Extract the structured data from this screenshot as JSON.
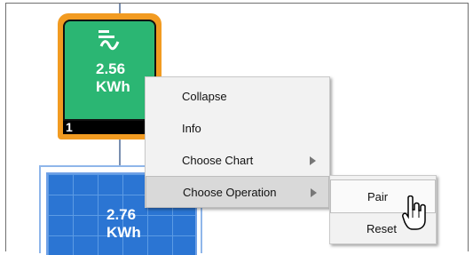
{
  "battery": {
    "energy": "2.56",
    "unit": "KWh",
    "index": "1",
    "fill_color": "#2bb673",
    "border_color": "#f29b21"
  },
  "solar": {
    "energy": "2.76",
    "unit": "KWh",
    "fill_color": "#2b75d3"
  },
  "context_menu": {
    "items": [
      {
        "label": "Collapse",
        "has_submenu": false
      },
      {
        "label": "Info",
        "has_submenu": false
      },
      {
        "label": "Choose Chart",
        "has_submenu": true
      },
      {
        "label": "Choose Operation",
        "has_submenu": true,
        "active": true
      }
    ]
  },
  "operation_submenu": {
    "items": [
      {
        "label": "Pair",
        "active": true
      },
      {
        "label": "Reset"
      }
    ]
  },
  "icons": [
    "battery-icon",
    "hand-cursor-icon",
    "submenu-arrow-icon"
  ]
}
